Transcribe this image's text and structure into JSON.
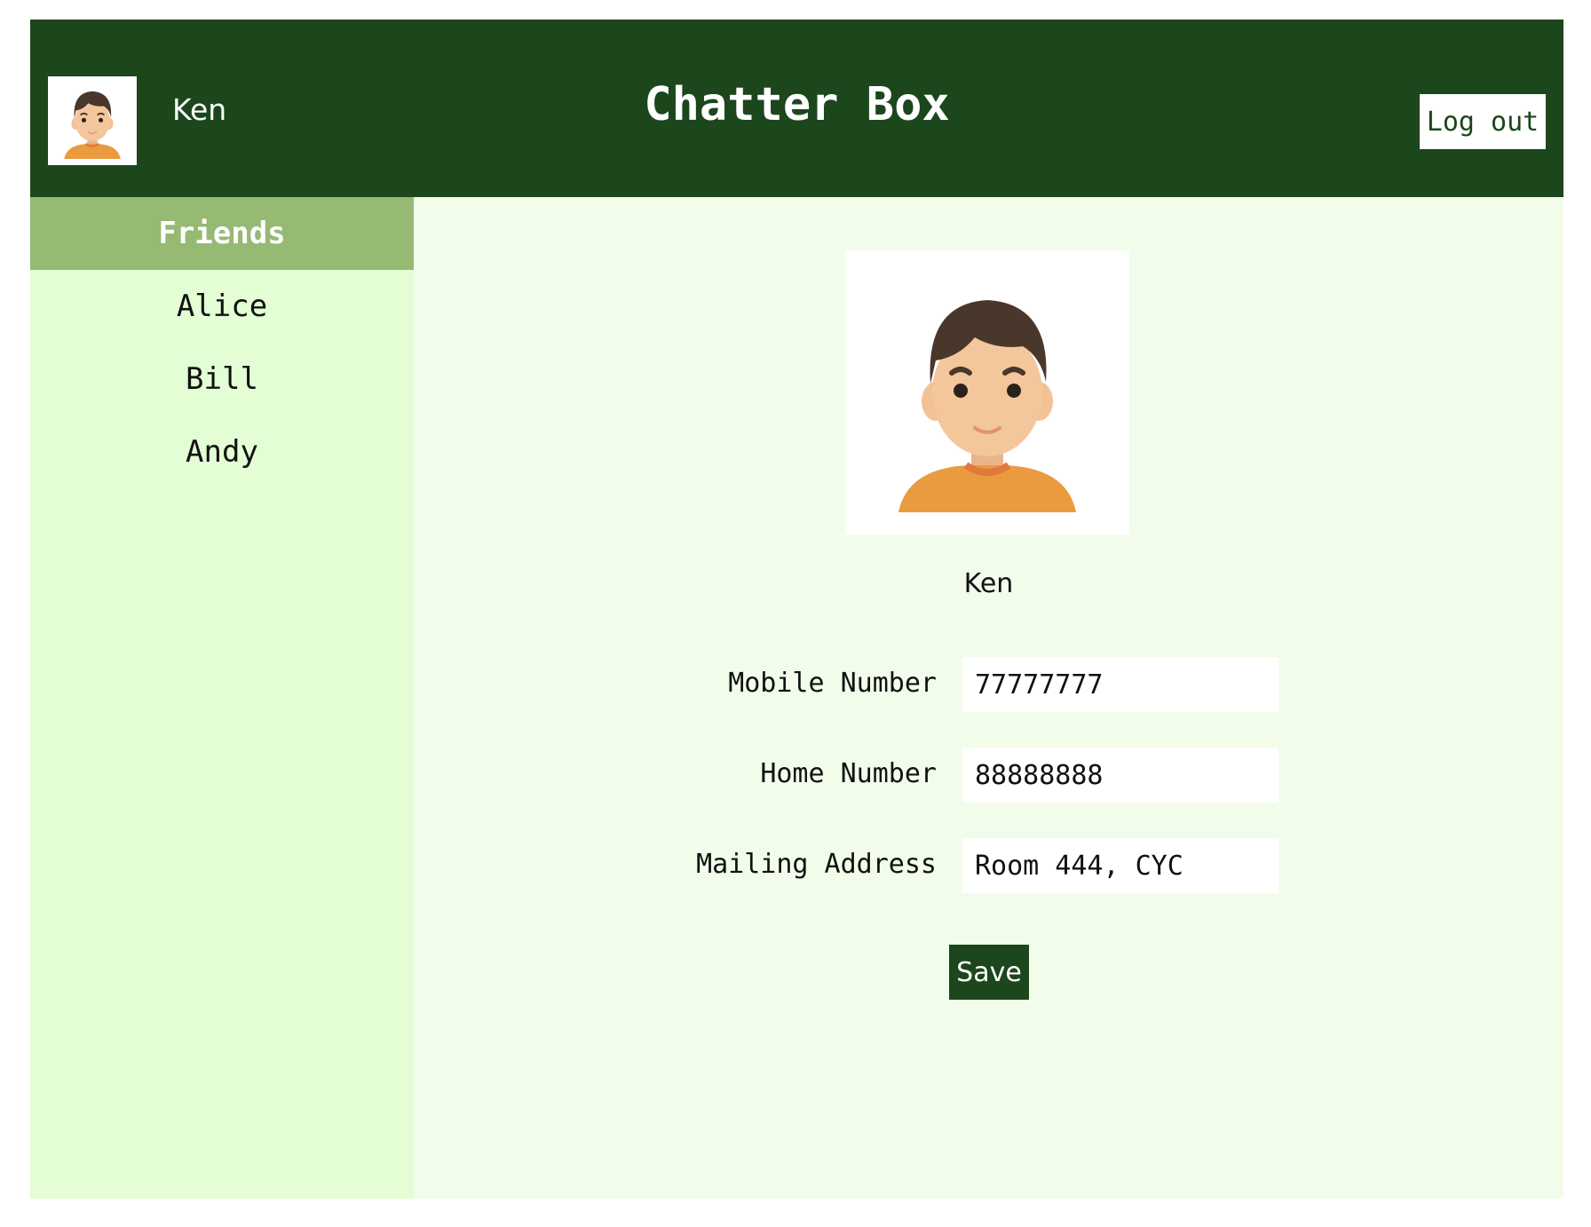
{
  "header": {
    "username": "Ken",
    "title": "Chatter Box",
    "logout_label": "Log out"
  },
  "sidebar": {
    "heading": "Friends",
    "friends": [
      {
        "label": "Alice"
      },
      {
        "label": "Bill"
      },
      {
        "label": "Andy"
      }
    ]
  },
  "profile": {
    "name": "Ken",
    "fields": [
      {
        "label": "Mobile Number",
        "value": "77777777"
      },
      {
        "label": "Home Number",
        "value": "88888888"
      },
      {
        "label": "Mailing Address",
        "value": "Room 444, CYC"
      }
    ],
    "save_label": "Save"
  },
  "colors": {
    "header_bg": "#1c461c",
    "sidebar_bg": "#e3fdd4",
    "sidebar_heading_bg": "#96b973",
    "main_bg": "#f1fdea"
  },
  "icons": {
    "avatar": "boy-avatar-icon"
  }
}
